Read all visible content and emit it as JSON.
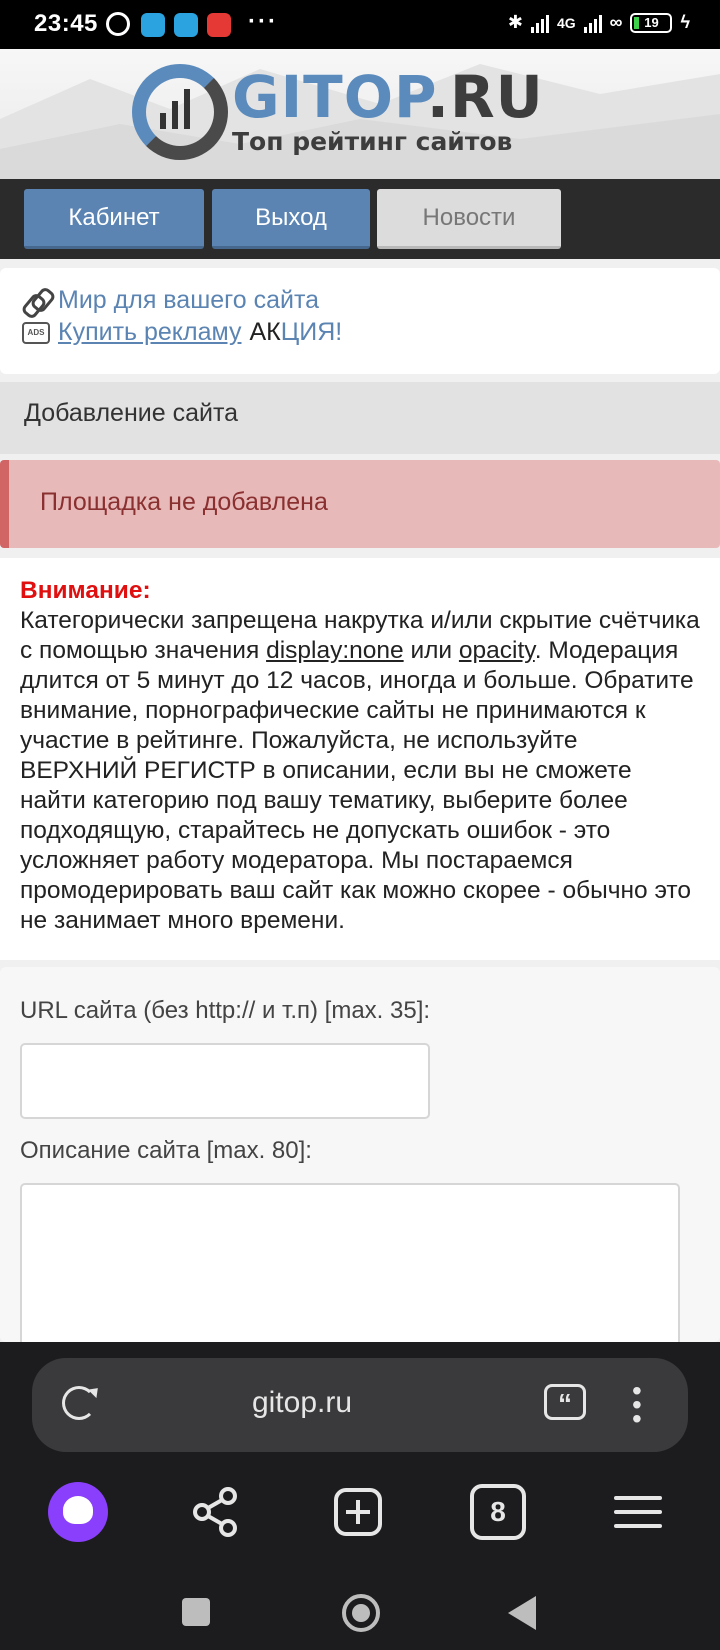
{
  "status_bar": {
    "time": "23:45",
    "network": "4G",
    "battery": "19",
    "icons": [
      "alarm-icon",
      "telegram-icon",
      "telegram-icon",
      "yandex-icon",
      "bluetooth-icon",
      "signal-icon",
      "signal-icon",
      "link-icon",
      "battery-icon",
      "charging-icon"
    ],
    "more": "···"
  },
  "header": {
    "logo_title_blue": "GITOP",
    "logo_title_dark": ".RU",
    "logo_subtitle": "Топ рейтинг сайтов"
  },
  "nav": {
    "cabinet": "Кабинет",
    "exit": "Выход",
    "news": "Новости"
  },
  "ads": {
    "line1": "Мир для вашего сайта",
    "line2_link": "Купить рекламу",
    "line2_black": "АК",
    "line2_blue": "ЦИЯ!",
    "ads_icon_text": "ADS"
  },
  "section_title": "Добавление сайта",
  "alert": "Площадка не добавлена",
  "warning": {
    "title": "Внимание:",
    "text_1": "Категорически запрещена накрутка и/или скрытие счётчика с помощью значения ",
    "link_1": "display:none",
    "text_2": " или ",
    "link_2": "opacity",
    "text_3": ". Модерация длится от 5 минут до 12 часов, иногда и больше. Обратите внимание, порнографические сайты не принимаются к участие в рейтинге. Пожалуйста, не используйте ВЕРХНИЙ РЕГИСТР в описании, если вы не сможете найти категорию под вашу тематику, выберите более подходящую, старайтесь не допускать ошибок - это усложняет работу модератора. Мы постараемся промодерировать ваш сайт как можно скорее - обычно это не занимает много времени."
  },
  "form": {
    "url_label": "URL сайта (без http:// и т.п) [max. 35]:",
    "url_value": "",
    "desc_label": "Описание сайта [max. 80]:",
    "desc_value": ""
  },
  "browser": {
    "url": "gitop.ru",
    "tab_count": "8",
    "quote_icon_text": "“"
  }
}
